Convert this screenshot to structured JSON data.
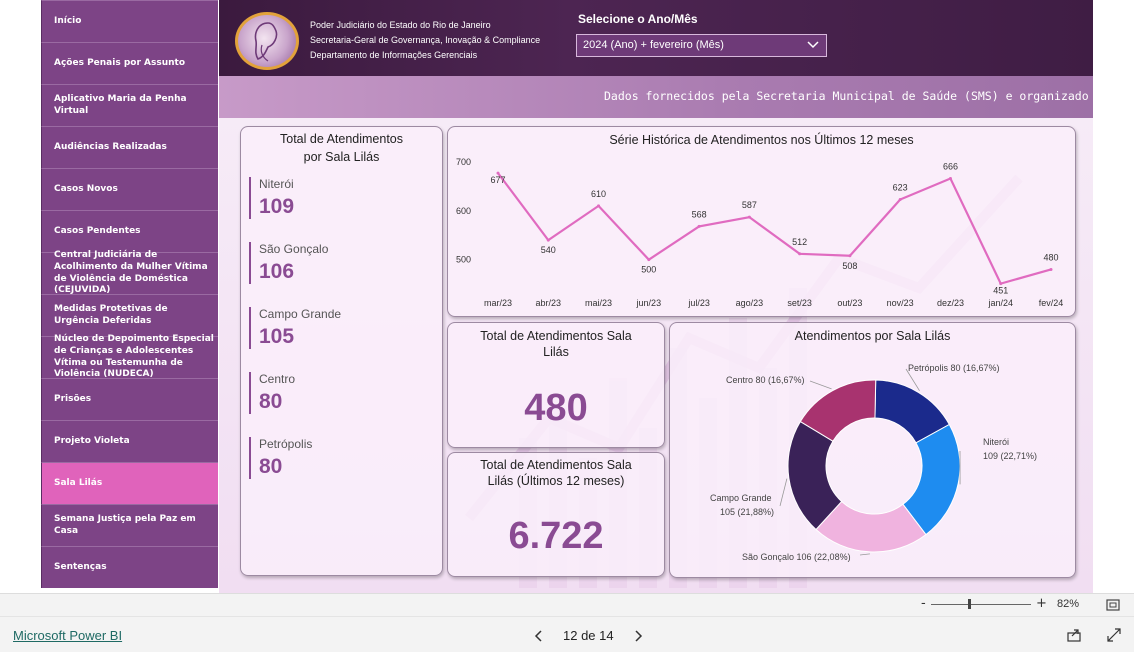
{
  "sidebar": {
    "items": [
      {
        "label": "Início"
      },
      {
        "label": "Ações Penais por Assunto"
      },
      {
        "label": "Aplicativo Maria da Penha Virtual"
      },
      {
        "label": "Audiências Realizadas"
      },
      {
        "label": "Casos Novos"
      },
      {
        "label": "Casos Pendentes"
      },
      {
        "label": "Central Judiciária de Acolhimento da Mulher Vítima de Violência de Doméstica (CEJUVIDA)"
      },
      {
        "label": "Medidas Protetivas de Urgência Deferidas"
      },
      {
        "label": "Núcleo de Depoimento Especial de Crianças e Adolescentes Vítima ou Testemunha de Violência (NUDECA)"
      },
      {
        "label": "Prisões"
      },
      {
        "label": "Projeto Violeta"
      },
      {
        "label": "Sala Lilás"
      },
      {
        "label": "Semana Justiça pela Paz em Casa"
      },
      {
        "label": "Sentenças"
      }
    ],
    "active_index": 11
  },
  "header": {
    "org_lines": [
      "Poder Judiciário do Estado do Rio de Janeiro",
      "Secretaria-Geral de Governança, Inovação & Compliance",
      "Departamento de Informações Gerenciais"
    ],
    "select_label": "Selecione o Ano/Mês",
    "select_value": "2024 (Ano) + fevereiro (Mês)"
  },
  "ticker": {
    "text": "Dados fornecidos pela Secretaria Municipal de Saúde (SMS) e organizado"
  },
  "totals_by_room": {
    "title_line1": "Total de Atendimentos",
    "title_line2": "por Sala Lilás",
    "rows": [
      {
        "name": "Niterói",
        "value": "109"
      },
      {
        "name": "São Gonçalo",
        "value": "106"
      },
      {
        "name": "Campo Grande",
        "value": "105"
      },
      {
        "name": "Centro",
        "value": "80"
      },
      {
        "name": "Petrópolis",
        "value": "80"
      }
    ]
  },
  "kpi_total": {
    "title_line1": "Total de Atendimentos Sala",
    "title_line2": "Lilás",
    "value": "480"
  },
  "kpi_12m": {
    "title_line1": "Total de Atendimentos Sala",
    "title_line2": "Lilás (Últimos 12 meses)",
    "value": "6.722"
  },
  "line_title": "Série Histórica de Atendimentos nos Últimos 12 meses",
  "donut_title": "Atendimentos por Sala Lilás",
  "chart_data": [
    {
      "type": "line",
      "title": "Série Histórica de Atendimentos nos Últimos 12 meses",
      "x": [
        "mar/23",
        "abr/23",
        "mai/23",
        "jun/23",
        "jul/23",
        "ago/23",
        "set/23",
        "out/23",
        "nov/23",
        "dez/23",
        "jan/24",
        "fev/24"
      ],
      "values": [
        677,
        540,
        610,
        500,
        568,
        587,
        512,
        508,
        623,
        666,
        451,
        480
      ],
      "yticks": [
        700,
        600,
        500
      ],
      "ylim": [
        440,
        710
      ],
      "color": "#e06bc0"
    },
    {
      "type": "pie",
      "title": "Atendimentos por Sala Lilás",
      "slices": [
        {
          "name": "Petrópolis",
          "value": 80,
          "label": "Petrópolis 80 (16,67%)",
          "color": "#1b2a8c"
        },
        {
          "name": "Niterói",
          "value": 109,
          "label_line1": "Niterói",
          "label_line2": "109 (22,71%)",
          "color": "#1e8cf0"
        },
        {
          "name": "São Gonçalo",
          "value": 106,
          "label": "São Gonçalo 106 (22,08%)",
          "color": "#f0b3df"
        },
        {
          "name": "Campo Grande",
          "value": 105,
          "label_line1": "Campo Grande",
          "label_line2": "105 (21,88%)",
          "color": "#3a2258"
        },
        {
          "name": "Centro",
          "value": 80,
          "label": "Centro 80 (16,67%)",
          "color": "#a8336f"
        }
      ]
    }
  ],
  "zoom": {
    "minus": "-",
    "plus": "+",
    "value": "82%"
  },
  "footer": {
    "brand": "Microsoft Power BI",
    "page": "12 de 14"
  }
}
